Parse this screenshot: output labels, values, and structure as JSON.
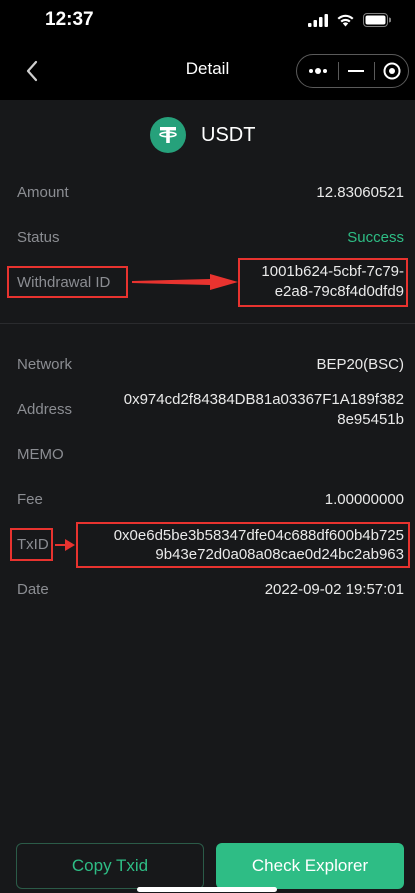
{
  "status_bar": {
    "time": "12:37"
  },
  "nav": {
    "title": "Detail"
  },
  "coin": {
    "name": "USDT"
  },
  "fields": {
    "amount": {
      "label": "Amount",
      "value": "12.83060521"
    },
    "status": {
      "label": "Status",
      "value": "Success"
    },
    "withdrawal_id": {
      "label": "Withdrawal ID",
      "value_line1": "1001b624-5cbf-7c79-",
      "value_line2": "e2a8-79c8f4d0dfd9"
    },
    "network": {
      "label": "Network",
      "value": "BEP20(BSC)"
    },
    "address": {
      "label": "Address",
      "value_line1": "0x974cd2f84384DB81a03367F1A189f382",
      "value_line2": "8e95451b"
    },
    "memo": {
      "label": "MEMO",
      "value": ""
    },
    "fee": {
      "label": "Fee",
      "value": "1.00000000"
    },
    "txid": {
      "label": "TxID",
      "value_line1": "0x0e6d5be3b58347dfe04c688df600b4b725",
      "value_line2": "9b43e72d0a08a08cae0d24bc2ab963"
    },
    "date": {
      "label": "Date",
      "value": "2022-09-02 19:57:01"
    }
  },
  "buttons": {
    "copy_txid": "Copy Txid",
    "check_explorer": "Check Explorer"
  },
  "colors": {
    "accent": "#2ebd85",
    "highlight": "#e8332f",
    "usdt": "#26a17b"
  }
}
